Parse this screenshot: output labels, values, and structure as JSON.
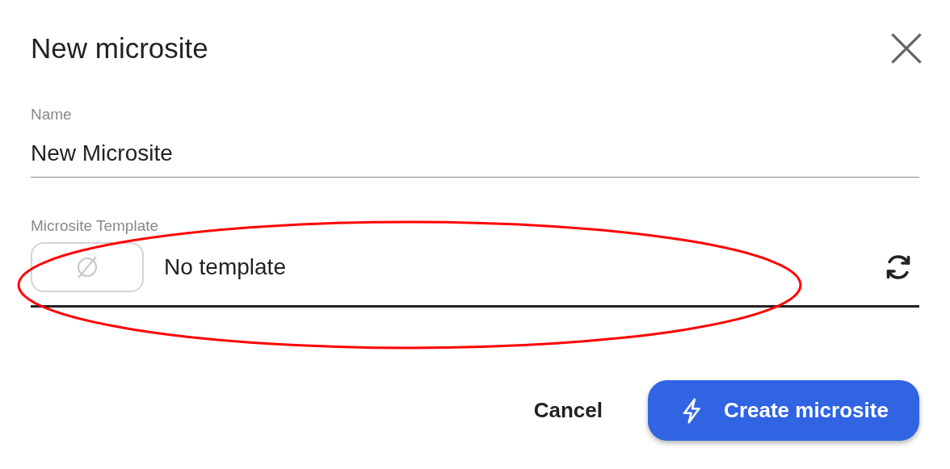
{
  "dialog": {
    "title": "New microsite"
  },
  "name_field": {
    "label": "Name",
    "value": "New Microsite"
  },
  "template_field": {
    "label": "Microsite Template",
    "value": "No template"
  },
  "buttons": [
    {
      "label": "Cancel",
      "kind": "text"
    },
    {
      "label": "Create microsite",
      "kind": "primary"
    }
  ]
}
